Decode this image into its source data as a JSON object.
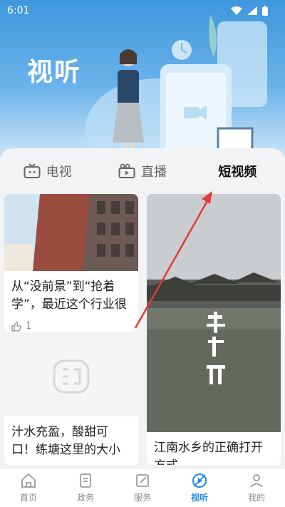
{
  "status_bar": {
    "time": "6:01"
  },
  "header": {
    "title": "视听"
  },
  "tabs": [
    {
      "label": "电视",
      "icon": "tv-icon"
    },
    {
      "label": "直播",
      "icon": "live-camera-icon"
    },
    {
      "label": "短视频",
      "icon": ""
    }
  ],
  "feed": {
    "cards": [
      {
        "title": "从“没前景”到“抢着学”，最近这个行业很",
        "likes": "1"
      },
      {
        "title": "江南水乡的正确打开方式",
        "likes": ""
      },
      {
        "title": "汁水充盈，酸甜可口！练塘这里的大小",
        "likes": ""
      }
    ]
  },
  "bottom_nav": [
    {
      "label": "首页",
      "icon": "home-icon"
    },
    {
      "label": "政务",
      "icon": "document-icon"
    },
    {
      "label": "服务",
      "icon": "edit-icon"
    },
    {
      "label": "视听",
      "icon": "play-circle-icon"
    },
    {
      "label": "我的",
      "icon": "user-icon"
    }
  ],
  "colors": {
    "accent": "#1c88e5",
    "hero": "#3f97dc",
    "annotation_arrow": "#e53935"
  }
}
